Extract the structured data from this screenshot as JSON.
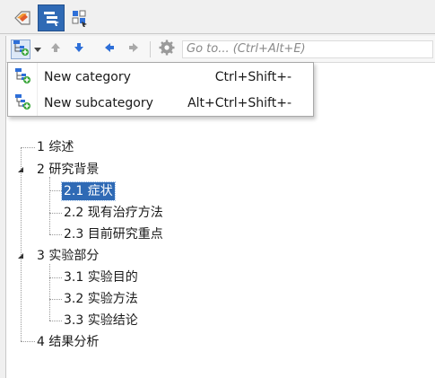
{
  "tabs": [
    {
      "icon": "bookmark-tag-icon"
    },
    {
      "icon": "outline-tree-icon",
      "active": true
    },
    {
      "icon": "structure-grid-icon"
    }
  ],
  "toolbar": {
    "add_button_icon": "add-category-icon",
    "up_icon": "arrow-up-icon",
    "down_icon": "arrow-down-icon",
    "left_icon": "arrow-left-icon",
    "right_icon": "arrow-right-icon",
    "settings_icon": "gear-icon",
    "goto_placeholder": "Go to... (Ctrl+Alt+E)"
  },
  "menu": {
    "items": [
      {
        "label": "New category",
        "shortcut": "Ctrl+Shift+-",
        "icon": "new-category-icon"
      },
      {
        "label": "New subcategory",
        "shortcut": "Alt+Ctrl+Shift+-",
        "icon": "new-subcategory-icon"
      }
    ]
  },
  "tree": {
    "nodes": [
      {
        "label": "1 综述",
        "level": 0,
        "expandable": false
      },
      {
        "label": "2 研究背景",
        "level": 0,
        "expandable": true,
        "expanded": true
      },
      {
        "label": "2.1 症状",
        "level": 1,
        "selected": true
      },
      {
        "label": "2.2 现有治疗方法",
        "level": 1
      },
      {
        "label": "2.3 目前研究重点",
        "level": 1
      },
      {
        "label": "3 实验部分",
        "level": 0,
        "expandable": true,
        "expanded": true
      },
      {
        "label": "3.1 实验目的",
        "level": 1
      },
      {
        "label": "3.2 实验方法",
        "level": 1
      },
      {
        "label": "3.3 实验结论",
        "level": 1
      },
      {
        "label": "4 结果分析",
        "level": 0,
        "expandable": false
      }
    ]
  },
  "colors": {
    "accent": "#2f6ab5",
    "arrow_blue": "#2e6fd8",
    "arrow_gray": "#a9a9a9",
    "icon_green": "#3aa63a"
  }
}
